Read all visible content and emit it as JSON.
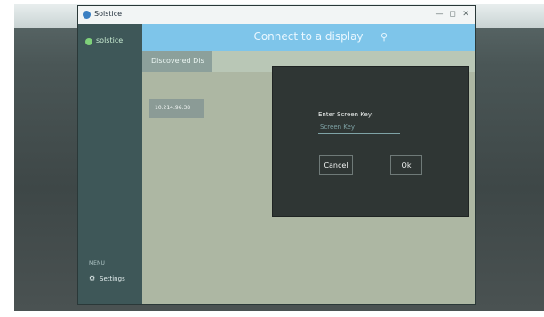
{
  "window": {
    "title": "Solstice",
    "controls": {
      "minimize": "—",
      "maximize": "◻",
      "close": "✕"
    }
  },
  "sidebar": {
    "brand_label": "solstice",
    "section_label": "MENU",
    "settings_label": "Settings"
  },
  "main": {
    "title": "Connect to a display",
    "pin_glyph": "⚲",
    "active_tab": "Discovered Dis",
    "list_item": "10.214.96.38"
  },
  "dialog": {
    "prompt": "Enter Screen Key:",
    "input_placeholder": "Screen Key",
    "input_value": "",
    "cancel": "Cancel",
    "ok": "Ok"
  },
  "colors": {
    "header": "#7ec5ea",
    "sidebar": "#3e5758",
    "dialog": "#2f3634",
    "accent_dot": "#7fd17a"
  }
}
